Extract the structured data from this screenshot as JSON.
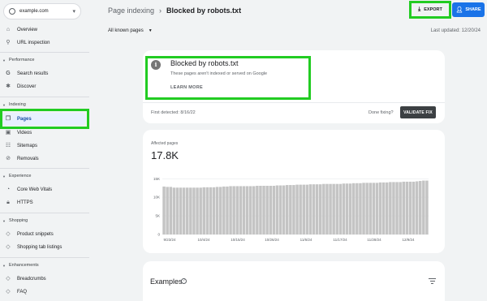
{
  "property": "example.com",
  "nav": {
    "overview": "Overview",
    "url_inspection": "URL inspection",
    "performance": "Performance",
    "search_results": "Search results",
    "discover": "Discover",
    "indexing": "Indexing",
    "pages": "Pages",
    "videos": "Videos",
    "sitemaps": "Sitemaps",
    "removals": "Removals",
    "experience": "Experience",
    "cwv": "Core Web Vitals",
    "https": "HTTPS",
    "shopping": "Shopping",
    "product_snippets": "Product snippets",
    "shopping_tab": "Shopping tab listings",
    "enhancements": "Enhancements",
    "breadcrumbs": "Breadcrumbs",
    "faq": "FAQ"
  },
  "header": {
    "parent": "Page indexing",
    "current": "Blocked by robots.txt",
    "export": "EXPORT",
    "share": "SHARE"
  },
  "filter": "All known pages",
  "last_updated": "Last updated: 12/20/24",
  "issue": {
    "title": "Blocked by robots.txt",
    "description": "These pages aren't indexed or served on Google",
    "learn_more": "LEARN MORE",
    "first_detected": "First detected: 8/16/22",
    "done_fixing": "Done fixing?",
    "validate": "VALIDATE FIX"
  },
  "affected": {
    "label": "Affected pages",
    "value": "17.8K"
  },
  "examples": {
    "title": "Examples",
    "help": "?"
  },
  "colors": {
    "bar": "#c4c4c4",
    "highlight": "#22cc22",
    "share_bg": "#1a73e8",
    "validate_bg": "#3c4043"
  },
  "chart_data": {
    "type": "bar",
    "y_ticks": [
      "0",
      "5K",
      "10K",
      "15K"
    ],
    "x_ticks": [
      "9/23/24",
      "10/4/24",
      "10/15/24",
      "10/26/24",
      "11/6/24",
      "11/17/24",
      "11/28/24",
      "12/9/24"
    ],
    "ylim": [
      0,
      15500
    ],
    "values": [
      12900,
      12800,
      12800,
      12600,
      12600,
      12600,
      12600,
      12600,
      12600,
      12600,
      12600,
      12600,
      12700,
      12700,
      12700,
      12700,
      12800,
      12800,
      12900,
      12900,
      13000,
      13000,
      13000,
      13000,
      13000,
      13000,
      13000,
      13000,
      13100,
      13100,
      13100,
      13100,
      13100,
      13100,
      13200,
      13200,
      13200,
      13300,
      13300,
      13300,
      13400,
      13400,
      13400,
      13400,
      13500,
      13500,
      13500,
      13500,
      13600,
      13600,
      13600,
      13600,
      13600,
      13600,
      13700,
      13700,
      13700,
      13800,
      13800,
      13800,
      13900,
      13900,
      13900,
      13900,
      13900,
      14000,
      14000,
      14000,
      14100,
      14100,
      14100,
      14100,
      14200,
      14200,
      14200,
      14200,
      14300,
      14400,
      14500,
      14500
    ]
  }
}
